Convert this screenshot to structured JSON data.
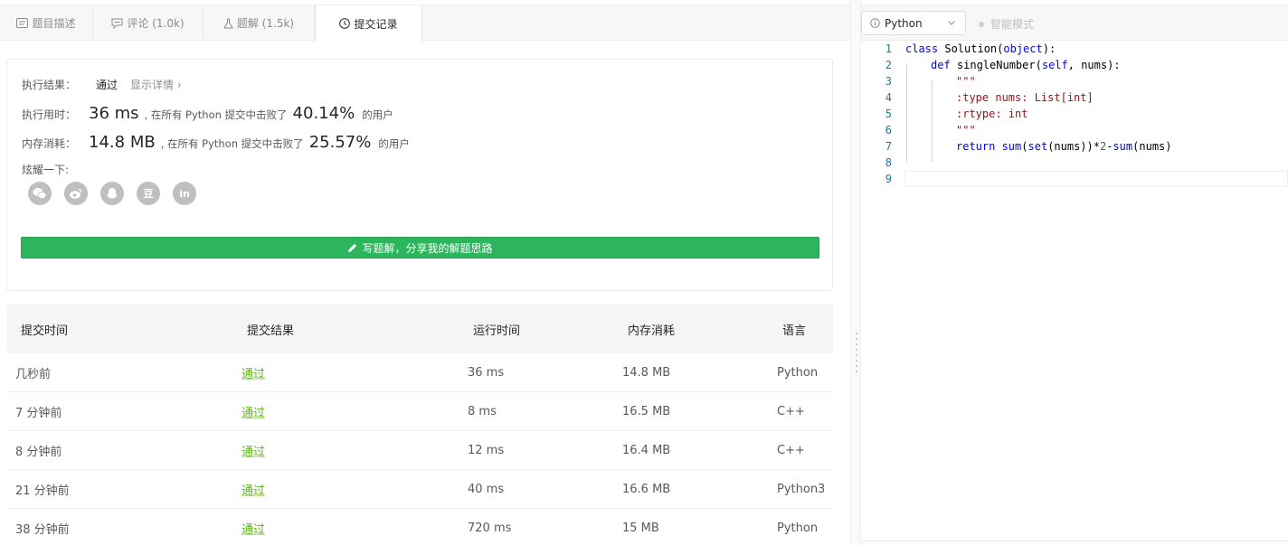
{
  "tabs": [
    {
      "label": "题目描述",
      "icon": "description-icon"
    },
    {
      "label": "评论 (1.0k)",
      "icon": "comment-icon"
    },
    {
      "label": "题解 (1.5k)",
      "icon": "flask-icon"
    },
    {
      "label": "提交记录",
      "icon": "clock-icon",
      "active": true
    }
  ],
  "result": {
    "exec_label": "执行结果：",
    "exec_value": "通过",
    "detail_link": "显示详情 ›",
    "time_label": "执行用时：",
    "time_value": "36 ms",
    "time_text": ", 在所有 Python 提交中击败了",
    "time_percent": "40.14%",
    "time_suffix": "的用户",
    "mem_label": "内存消耗：",
    "mem_value": "14.8 MB",
    "mem_text": ", 在所有 Python 提交中击败了",
    "mem_percent": "25.57%",
    "mem_suffix": "的用户",
    "share_label": "炫耀一下:",
    "share_icons": [
      "wechat-icon",
      "weibo-icon",
      "qq-icon",
      "douban-icon",
      "linkedin-icon"
    ],
    "douban_glyph": "豆",
    "linkedin_glyph": "in",
    "write_button": "写题解，分享我的解题思路"
  },
  "table": {
    "headers": [
      "提交时间",
      "提交结果",
      "运行时间",
      "内存消耗",
      "语言"
    ],
    "rows": [
      [
        "几秒前",
        "通过",
        "36 ms",
        "14.8 MB",
        "Python"
      ],
      [
        "7 分钟前",
        "通过",
        "8 ms",
        "16.5 MB",
        "C++"
      ],
      [
        "8 分钟前",
        "通过",
        "12 ms",
        "16.4 MB",
        "C++"
      ],
      [
        "21 分钟前",
        "通过",
        "40 ms",
        "16.6 MB",
        "Python3"
      ],
      [
        "38 分钟前",
        "通过",
        "720 ms",
        "15 MB",
        "Python"
      ]
    ]
  },
  "editor": {
    "language": "Python",
    "smart_mode": "智能模式",
    "line_numbers": [
      "1",
      "2",
      "3",
      "4",
      "5",
      "6",
      "7",
      "8",
      "9"
    ],
    "code": {
      "l1_kw": "class",
      "l1_name": " Solution(",
      "l1_obj": "object",
      "l1_end": "):",
      "l2_kw": "def",
      "l2_name": " singleNumber(",
      "l2_self": "self",
      "l2_end": ", nums):",
      "l3": "\"\"\"",
      "l4": ":type nums: List[int]",
      "l5": ":rtype: int",
      "l6": "\"\"\"",
      "l7_kw": "return",
      "l7_sum": " sum",
      "l7_mid1": "(",
      "l7_set": "set",
      "l7_mid2": "(nums))*",
      "l7_num": "2",
      "l7_mid3": "-",
      "l7_sum2": "sum",
      "l7_end": "(nums)"
    }
  },
  "colors": {
    "accent_green": "#2db55d",
    "pass_green": "#5cb814",
    "keyword_blue": "#0000ff",
    "string_red": "#a31515"
  }
}
